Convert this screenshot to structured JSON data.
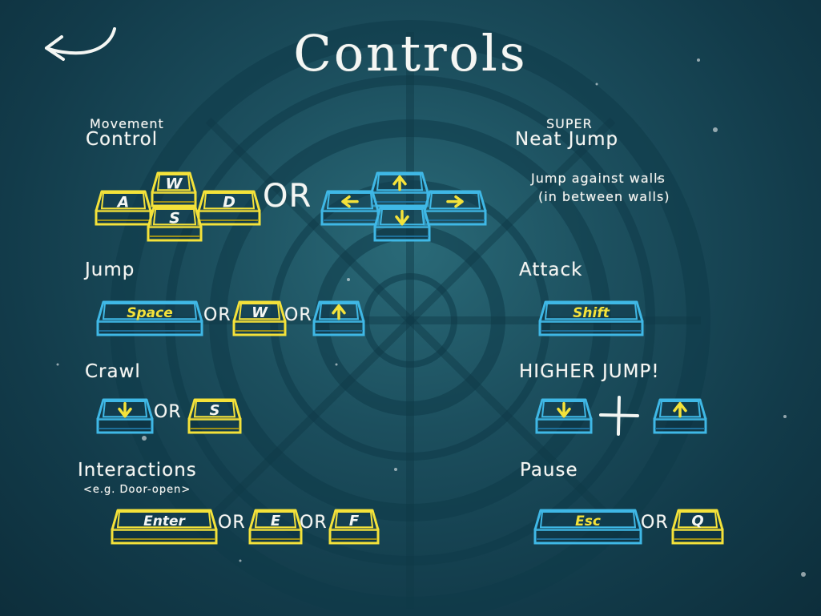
{
  "title": "Controls",
  "colors": {
    "blue": "#3fb8e6",
    "blueDark": "#1e6f99",
    "yellow": "#f4e23a",
    "yellowDark": "#9b8f1a",
    "chalk": "#f4f6f3"
  },
  "icons": {
    "back": "back-arrow-icon",
    "up": "arrow-up-icon",
    "down": "arrow-down-icon",
    "left": "arrow-left-icon",
    "right": "arrow-right-icon",
    "plus": "plus-icon"
  },
  "movement": {
    "small": "Movement",
    "big": "Control",
    "or": "OR",
    "keys": {
      "w": "W",
      "a": "A",
      "s": "S",
      "d": "D"
    }
  },
  "neat": {
    "small": "SUPER",
    "big": "Neat Jump",
    "desc1": "Jump against walls",
    "desc2": "(in between walls)"
  },
  "jump": {
    "label": "Jump",
    "space": "Space",
    "w": "W",
    "or": "OR"
  },
  "attack": {
    "label": "Attack",
    "shift": "Shift"
  },
  "crawl": {
    "label": "Crawl",
    "s": "S",
    "or": "OR"
  },
  "higher": {
    "label": "HIGHER JUMP!"
  },
  "interactions": {
    "label": "Interactions",
    "sub": "<e.g. Door-open>",
    "enter": "Enter",
    "e": "E",
    "f": "F",
    "or": "OR"
  },
  "pause": {
    "label": "Pause",
    "esc": "Esc",
    "q": "Q",
    "or": "OR"
  }
}
